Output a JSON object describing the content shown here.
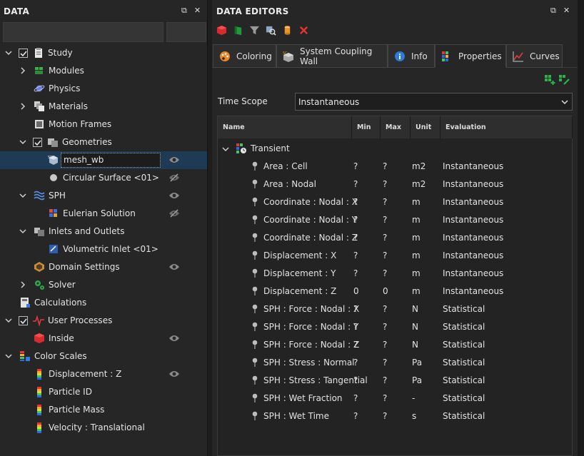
{
  "left_panel": {
    "title": "DATA",
    "tree": [
      {
        "label": "Study",
        "icon": "clipboard-icon",
        "chevron": "down",
        "checkbox": true,
        "level": 0
      },
      {
        "label": "Modules",
        "icon": "modules-icon",
        "chevron": "right",
        "checkbox": false,
        "level": 1
      },
      {
        "label": "Physics",
        "icon": "planet-icon",
        "chevron": "",
        "checkbox": false,
        "level": 1
      },
      {
        "label": "Materials",
        "icon": "materials-icon",
        "chevron": "right",
        "checkbox": false,
        "level": 1
      },
      {
        "label": "Motion Frames",
        "icon": "motion-frames-icon",
        "chevron": "",
        "checkbox": false,
        "level": 1
      },
      {
        "label": "Geometries",
        "icon": "geometries-icon",
        "chevron": "down",
        "checkbox": true,
        "level": 1
      },
      {
        "label": "mesh_wb",
        "icon": "mesh-icon",
        "chevron": "",
        "checkbox": false,
        "level": 2,
        "selected": true,
        "eye": "visible"
      },
      {
        "label": "Circular Surface <01>",
        "icon": "circle-icon",
        "chevron": "",
        "checkbox": false,
        "level": 2,
        "eye": "hidden"
      },
      {
        "label": "SPH",
        "icon": "waves-icon",
        "chevron": "down",
        "checkbox": false,
        "level": 1,
        "eye": "visible"
      },
      {
        "label": "Eulerian Solution",
        "icon": "eulerian-icon",
        "chevron": "",
        "checkbox": false,
        "level": 2,
        "eye": "hidden"
      },
      {
        "label": "Inlets and Outlets",
        "icon": "inlets-icon",
        "chevron": "down",
        "checkbox": false,
        "level": 1
      },
      {
        "label": "Volumetric Inlet <01>",
        "icon": "volumetric-inlet-icon",
        "chevron": "",
        "checkbox": false,
        "level": 2
      },
      {
        "label": "Domain Settings",
        "icon": "domain-icon",
        "chevron": "",
        "checkbox": false,
        "level": 1,
        "eye": "visible"
      },
      {
        "label": "Solver",
        "icon": "solver-gears-icon",
        "chevron": "right",
        "checkbox": false,
        "level": 1
      },
      {
        "label": "Calculations",
        "icon": "calculator-icon",
        "chevron": "",
        "checkbox": false,
        "level": 0
      },
      {
        "label": "User Processes",
        "icon": "pulse-icon",
        "chevron": "down",
        "checkbox": true,
        "level": 0
      },
      {
        "label": "Inside",
        "icon": "red-cube-icon",
        "chevron": "",
        "checkbox": false,
        "level": 1,
        "eye": "visible"
      },
      {
        "label": "Color Scales",
        "icon": "color-scales-icon",
        "chevron": "down",
        "checkbox": false,
        "level": 0
      },
      {
        "label": "Displacement : Z",
        "icon": "color-bar-icon",
        "chevron": "",
        "checkbox": false,
        "level": 1,
        "eye": "visible"
      },
      {
        "label": "Particle ID",
        "icon": "color-bar-icon",
        "chevron": "",
        "checkbox": false,
        "level": 1
      },
      {
        "label": "Particle Mass",
        "icon": "color-bar-icon",
        "chevron": "",
        "checkbox": false,
        "level": 1
      },
      {
        "label": "Velocity : Translational",
        "icon": "color-bar-icon",
        "chevron": "",
        "checkbox": false,
        "level": 1
      }
    ]
  },
  "right_panel": {
    "title": "DATA EDITORS",
    "tabs": [
      {
        "label": "Coloring",
        "icon": "palette-icon"
      },
      {
        "label": "System Coupling Wall",
        "icon": "coupling-wall-icon"
      },
      {
        "label": "Info",
        "icon": "info-icon"
      },
      {
        "label": "Properties",
        "icon": "properties-icon",
        "active": true
      },
      {
        "label": "Curves",
        "icon": "curves-icon"
      }
    ],
    "time_scope_label": "Time Scope",
    "time_scope_value": "Instantaneous",
    "grid": {
      "columns": [
        "Name",
        "Min",
        "Max",
        "Unit",
        "Evaluation"
      ],
      "group_label": "Transient",
      "rows": [
        {
          "name": "Area : Cell",
          "min": "?",
          "max": "?",
          "unit": "m2",
          "eval": "Instantaneous"
        },
        {
          "name": "Area : Nodal",
          "min": "?",
          "max": "?",
          "unit": "m2",
          "eval": "Instantaneous"
        },
        {
          "name": "Coordinate : Nodal : X",
          "min": "?",
          "max": "?",
          "unit": "m",
          "eval": "Instantaneous"
        },
        {
          "name": "Coordinate : Nodal : Y",
          "min": "?",
          "max": "?",
          "unit": "m",
          "eval": "Instantaneous"
        },
        {
          "name": "Coordinate : Nodal : Z",
          "min": "?",
          "max": "?",
          "unit": "m",
          "eval": "Instantaneous"
        },
        {
          "name": "Displacement : X",
          "min": "?",
          "max": "?",
          "unit": "m",
          "eval": "Instantaneous"
        },
        {
          "name": "Displacement : Y",
          "min": "?",
          "max": "?",
          "unit": "m",
          "eval": "Instantaneous"
        },
        {
          "name": "Displacement : Z",
          "min": "0",
          "max": "0",
          "unit": "m",
          "eval": "Instantaneous"
        },
        {
          "name": "SPH : Force : Nodal : X",
          "min": "?",
          "max": "?",
          "unit": "N",
          "eval": "Statistical"
        },
        {
          "name": "SPH : Force : Nodal : Y",
          "min": "?",
          "max": "?",
          "unit": "N",
          "eval": "Statistical"
        },
        {
          "name": "SPH : Force : Nodal : Z",
          "min": "?",
          "max": "?",
          "unit": "N",
          "eval": "Statistical"
        },
        {
          "name": "SPH : Stress : Normal",
          "min": "?",
          "max": "?",
          "unit": "Pa",
          "eval": "Statistical"
        },
        {
          "name": "SPH : Stress : Tangential",
          "min": "?",
          "max": "?",
          "unit": "Pa",
          "eval": "Statistical"
        },
        {
          "name": "SPH : Wet Fraction",
          "min": "?",
          "max": "?",
          "unit": "-",
          "eval": "Statistical"
        },
        {
          "name": "SPH : Wet Time",
          "min": "?",
          "max": "?",
          "unit": "s",
          "eval": "Statistical"
        }
      ]
    }
  },
  "colors": {
    "background": "#1e1e1e",
    "panel": "#262626",
    "selection": "#1f3a55",
    "text": "#e6e6e6"
  }
}
